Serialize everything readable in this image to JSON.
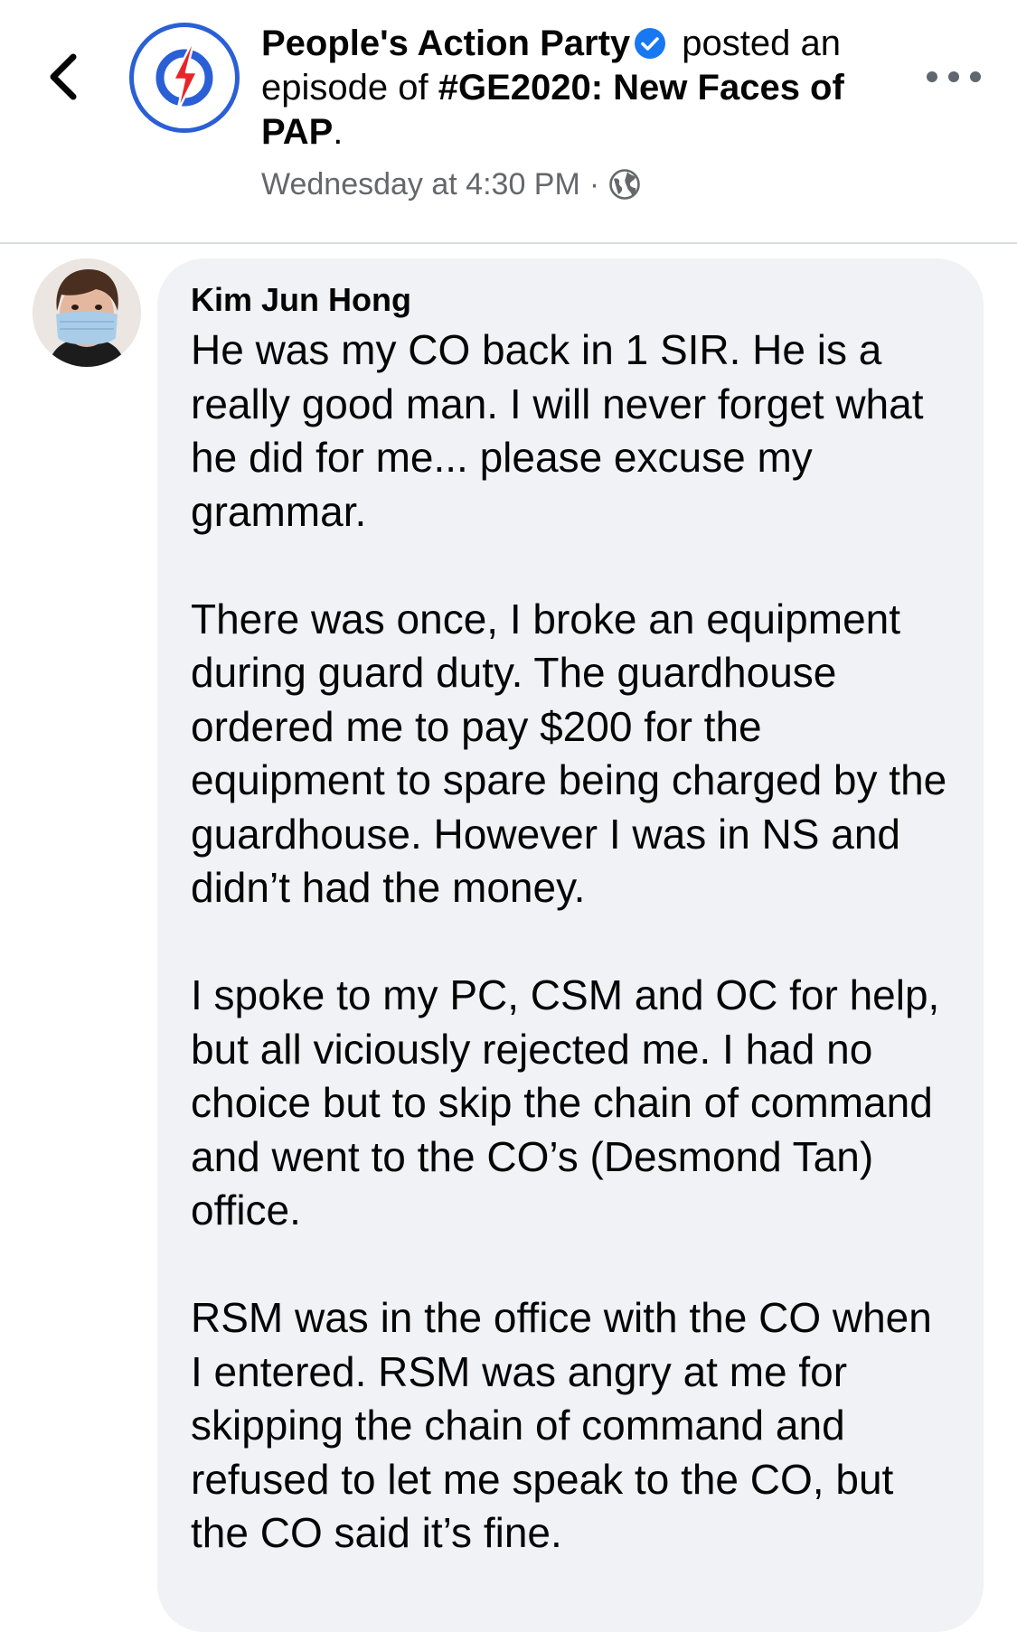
{
  "header": {
    "page_name": "People's Action Party",
    "action_text": " posted an episode of ",
    "episode_title": "#GE2020: New Faces of PAP",
    "period": ".",
    "timestamp": "Wednesday at 4:30 PM",
    "separator": "·",
    "icons": {
      "back": "chevron-left-icon",
      "verified": "verified-badge-icon",
      "privacy": "globe-icon",
      "more": "more-horizontal-icon"
    },
    "colors": {
      "verified_blue": "#1877f2",
      "logo_ring": "#2a5fd6",
      "logo_bolt": "#e8252a"
    }
  },
  "comment": {
    "author": "Kim Jun Hong",
    "paragraphs": [
      "He was my CO back in 1 SIR. He is a really good man. I will never forget what he did for me... please excuse my grammar.",
      "There was once, I broke an equipment during guard duty. The guardhouse ordered me to pay $200 for the equipment to spare being charged by the guardhouse. However I was in NS and didn’t had the money.",
      "I spoke to my PC, CSM and OC for help, but all viciously rejected me. I had no choice but to skip the chain of command and went to the CO’s (Desmond Tan) office.",
      "RSM was in the office with the CO when I entered. RSM was angry at me for skipping the chain of command and refused to let me speak to the CO, but the CO said it’s fine."
    ]
  }
}
